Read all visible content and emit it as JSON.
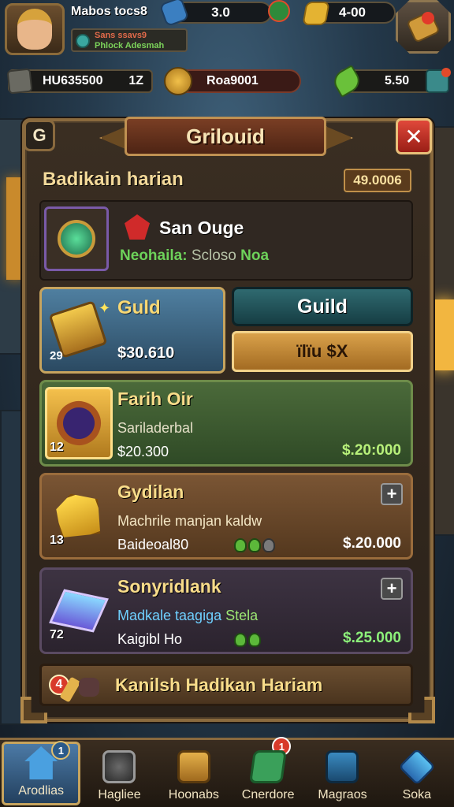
{
  "hud": {
    "player_name": "Mabos tocs8",
    "player_sub_line1": "Sans ssavs9",
    "player_sub_line2": "Phlock Adesmah",
    "resource_a": "3.0",
    "resource_b": "4-00",
    "resource_left": "HU635500",
    "resource_left_tag": "1Z",
    "resource_mid": "Roa9001",
    "resource_right": "5.50"
  },
  "panel": {
    "back_label": "G",
    "title": "Grilouid",
    "close_label": "✕",
    "section_title": "Badikain harian",
    "section_value": "49.0006",
    "info_name": "San Ouge",
    "info_stat_prefix": "Neohaila:",
    "info_stat_mid": "Scloso",
    "info_stat_suffix": "Noa"
  },
  "guild_card": {
    "name": "Guld",
    "price": "$30.610",
    "level": "29",
    "button_guild": "Guild",
    "button_buy": "ïlïu $X"
  },
  "rows": [
    {
      "name": "Farih Oir",
      "desc": "Sariladerbal",
      "sub": "$20.300",
      "price": "$.20:000",
      "level": "12"
    },
    {
      "name": "Gydilan",
      "desc": "Machrile manjan kaldw",
      "sub": "Baideoal80",
      "price": "$.20.000",
      "level": "13"
    },
    {
      "name": "Sonyridlank",
      "desc_a": "Madkale taagiga",
      "desc_b": "Stela",
      "sub": "Kaigibl Ho",
      "price": "$.25.000",
      "level": "72"
    }
  ],
  "footer": {
    "badge": "4",
    "text": "Kanilsh Hadikan Hariam"
  },
  "nav": [
    {
      "label": "Arodlias",
      "badge": "1"
    },
    {
      "label": "Hagliee"
    },
    {
      "label": "Hoonabs"
    },
    {
      "label": "Cnerdore",
      "badge": "1"
    },
    {
      "label": "Magraos"
    },
    {
      "label": "Soka"
    }
  ],
  "colors": {
    "panel_border": "#8a6a3e",
    "title_plate": "#7a3e24",
    "close_button": "#d43a2e",
    "guild_card": "#4f7fa0",
    "green_stat": "#6dd25a"
  }
}
